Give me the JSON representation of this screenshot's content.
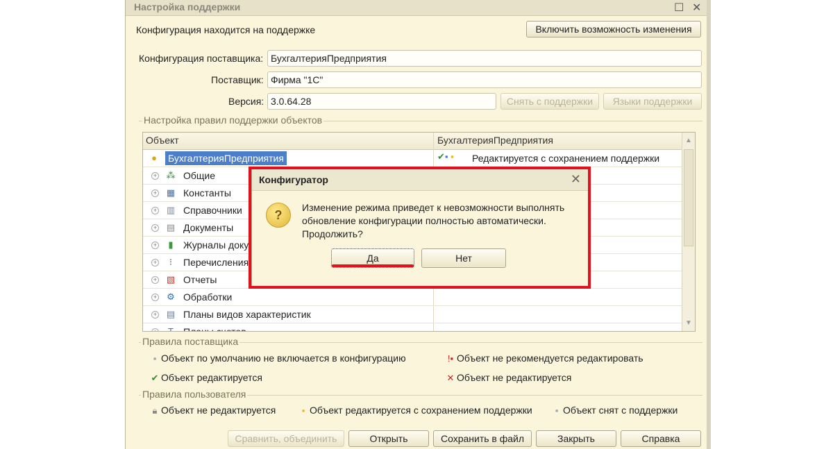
{
  "window": {
    "title": "Настройка поддержки"
  },
  "status": {
    "text": "Конфигурация находится на поддержке",
    "enable_button": "Включить возможность изменения"
  },
  "fields": {
    "vendor_config_label": "Конфигурация поставщика:",
    "vendor_config_value": "БухгалтерияПредприятия",
    "vendor_label": "Поставщик:",
    "vendor_value": "Фирма \"1С\"",
    "version_label": "Версия:",
    "version_value": "3.0.64.28",
    "remove_support_button": "Снять с поддержки",
    "support_languages_button": "Языки поддержки"
  },
  "rules_group": {
    "title": "Настройка правил поддержки объектов",
    "columns": [
      "Объект",
      "БухгалтерияПредприятия"
    ],
    "root": {
      "name": "БухгалтерияПредприятия",
      "status": "Редактируется с сохранением поддержки"
    },
    "rows": [
      {
        "name": "Общие",
        "icon": "common-icon"
      },
      {
        "name": "Константы",
        "icon": "constants-icon"
      },
      {
        "name": "Справочники",
        "icon": "catalogs-icon"
      },
      {
        "name": "Документы",
        "icon": "documents-icon"
      },
      {
        "name": "Журналы доку",
        "icon": "journals-icon"
      },
      {
        "name": "Перечисления",
        "icon": "enums-icon"
      },
      {
        "name": "Отчеты",
        "icon": "reports-icon"
      },
      {
        "name": "Обработки",
        "icon": "processing-icon"
      },
      {
        "name": "Планы видов характеристик",
        "icon": "characteristics-icon"
      },
      {
        "name": "Планы счетов",
        "icon": "accounts-icon"
      }
    ]
  },
  "vendor_rules": {
    "title": "Правила поставщика",
    "items": [
      "Объект по умолчанию не включается в конфигурацию",
      "Объект не рекомендуется редактировать",
      "Объект редактируется",
      "Объект не редактируется"
    ]
  },
  "user_rules": {
    "title": "Правила пользователя",
    "items": [
      "Объект не редактируется",
      "Объект редактируется с сохранением поддержки",
      "Объект снят с поддержки"
    ]
  },
  "footer": {
    "compare_button": "Сравнить, объединить",
    "open_button": "Открыть",
    "save_button": "Сохранить в файл",
    "close_button": "Закрыть",
    "help_button": "Справка"
  },
  "dialog": {
    "title": "Конфигуратор",
    "line1": "Изменение режима приведет к невозможности выполнять",
    "line2": "обновление конфигурации полностью автоматически.",
    "line3": "Продолжить?",
    "yes_button": "Да",
    "no_button": "Нет"
  },
  "colors": {
    "highlight": "#e1121e",
    "selection": "#4d7fc9",
    "window_bg": "#fbf5dc"
  }
}
